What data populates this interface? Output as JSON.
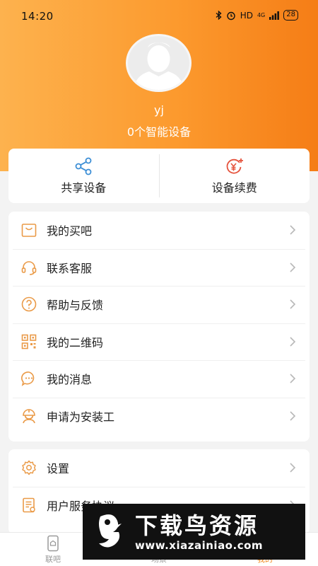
{
  "status_bar": {
    "time": "14:20",
    "signal": "HD",
    "network": "4G",
    "battery": "28"
  },
  "profile": {
    "username": "yj",
    "device_count": "0个智能设备"
  },
  "actions": [
    {
      "label": "共享设备",
      "icon": "share-icon"
    },
    {
      "label": "设备续费",
      "icon": "renew-fee-icon"
    }
  ],
  "menu_primary": [
    {
      "label": "我的买吧",
      "icon": "shopping-bag-icon"
    },
    {
      "label": "联系客服",
      "icon": "headset-icon"
    },
    {
      "label": "帮助与反馈",
      "icon": "help-icon"
    },
    {
      "label": "我的二维码",
      "icon": "qr-code-icon"
    },
    {
      "label": "我的消息",
      "icon": "message-icon"
    },
    {
      "label": "申请为安装工",
      "icon": "worker-icon"
    }
  ],
  "menu_secondary": [
    {
      "label": "设置",
      "icon": "gear-icon"
    },
    {
      "label": "用户服务协议",
      "icon": "document-icon"
    }
  ],
  "tabbar": [
    {
      "label": "联吧",
      "icon": "phone-icon"
    },
    {
      "label": "场景",
      "icon": "scene-icon"
    },
    {
      "label": "我的",
      "icon": "profile-icon",
      "active": true
    }
  ],
  "watermark": {
    "title": "下载鸟资源",
    "url": "www.xiazainiao.com"
  },
  "colors": {
    "accent": "#f08a24",
    "header_start": "#fdb24e",
    "header_end": "#f57d16",
    "share_icon": "#3d8fd6",
    "fee_icon": "#e5533d"
  }
}
